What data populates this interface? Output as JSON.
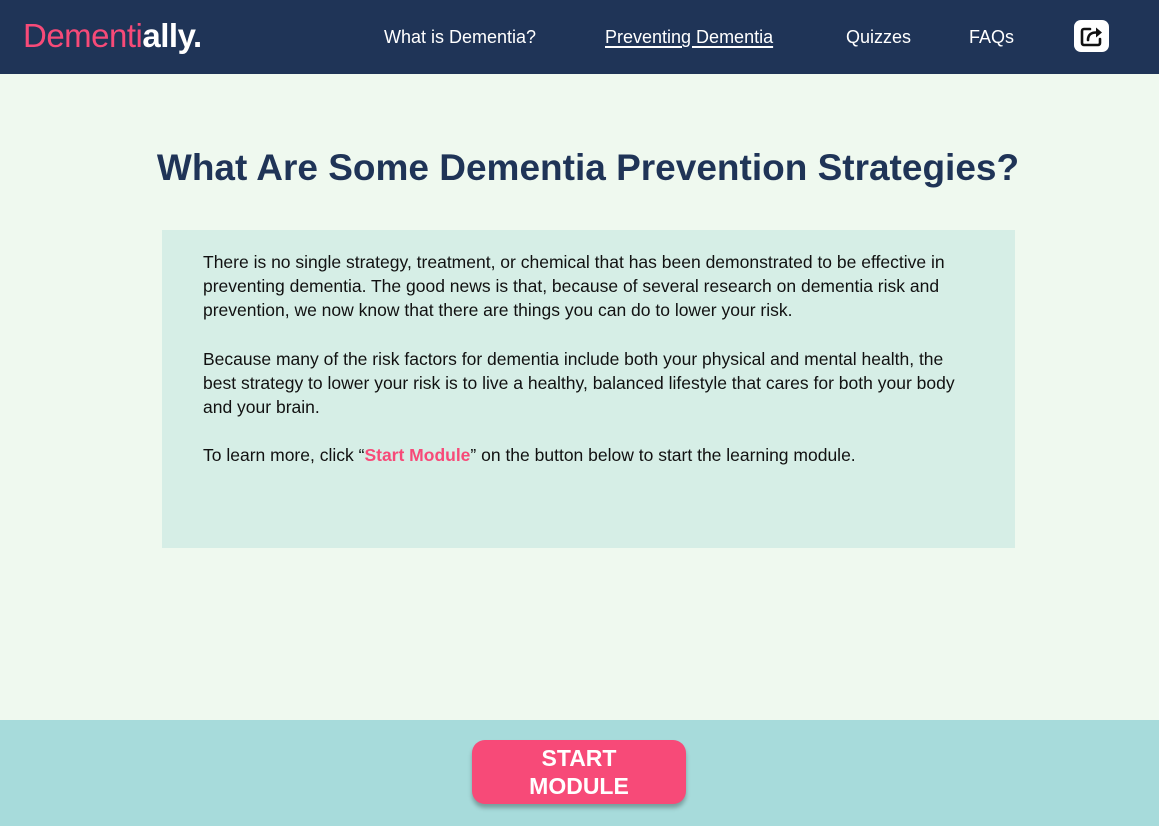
{
  "header": {
    "logo_part1": "Dementi",
    "logo_part2": "ally.",
    "nav": [
      {
        "label": "What is Dementia?"
      },
      {
        "label": "Preventing Dementia",
        "active": true
      },
      {
        "label": "Quizzes"
      },
      {
        "label": "FAQs"
      }
    ],
    "share_icon": "share-icon"
  },
  "main": {
    "title": "What Are Some Dementia Prevention Strategies?",
    "paragraph1": "There is no single strategy, treatment, or chemical that has been demonstrated to be effective in preventing dementia. The good news is that, because of several research on dementia risk and prevention, we now know that there are things you can do to lower your risk.",
    "paragraph2": "Because many of the risk factors for dementia include both your physical and mental health, the best strategy to lower your risk is to live a healthy, balanced lifestyle that cares for both your body and your brain.",
    "paragraph3_before": "To learn more, click “",
    "paragraph3_highlight": "Start Module",
    "paragraph3_after": "” on the button below to start the learning module."
  },
  "footer": {
    "start_button": "START MODULE"
  },
  "colors": {
    "navy": "#1f3457",
    "pink": "#f74a78",
    "background": "#eff9ef",
    "info_box": "#d6eee6",
    "footer_bar": "#a7dbdb"
  }
}
